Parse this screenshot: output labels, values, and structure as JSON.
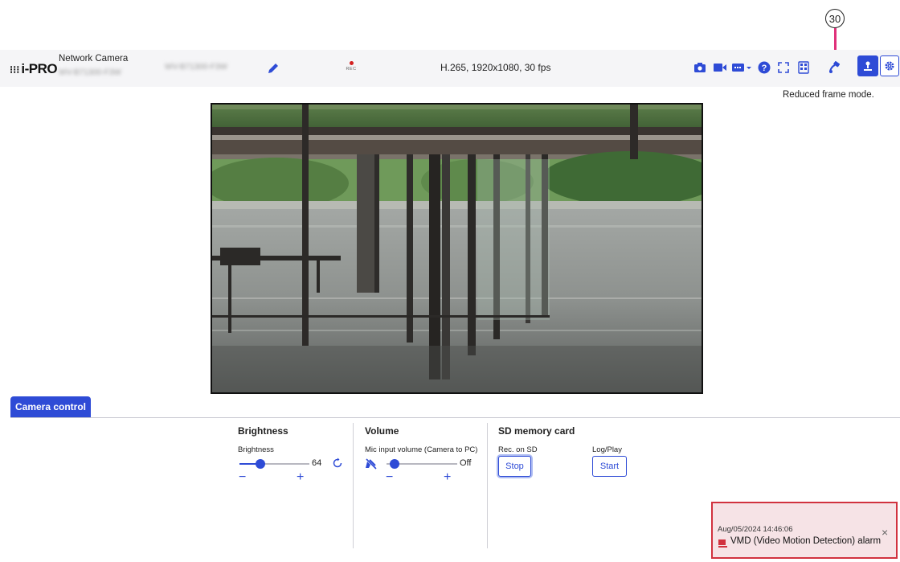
{
  "callout": {
    "number": "30"
  },
  "header": {
    "logo_dots": "⁝⁝⁝",
    "logo_text": "i-PRO",
    "brand_sub": "Network Camera",
    "model_blurred_1": "WV-B71300-F3W",
    "model_blurred_2": "WV-B71300-F3W",
    "rec_label": "REC",
    "stream_info": "H.265, 1920x1080, 30 fps",
    "reduced_frame_label": "Reduced frame mode.",
    "toolbar_icons": [
      "camera-snapshot-icon",
      "video-record-icon",
      "stream-select-icon",
      "help-icon",
      "fullscreen-icon",
      "grid-icon",
      "reduced-frame-icon",
      "live-icon",
      "settings-icon"
    ]
  },
  "camera_control": {
    "tab_label": "Camera control",
    "brightness": {
      "title": "Brightness",
      "label": "Brightness",
      "value": "64",
      "level_fraction": 0.3,
      "minus": "−",
      "plus": "+"
    },
    "volume": {
      "title": "Volume",
      "label": "Mic input volume (Camera to PC)",
      "value": "Off",
      "level_fraction": 0.0,
      "minus": "−",
      "plus": "+"
    },
    "sd_card": {
      "title": "SD memory card",
      "rec_label": "Rec. on SD",
      "rec_button": "Stop",
      "log_label": "Log/Play",
      "log_button": "Start"
    }
  },
  "alarm": {
    "timestamp": "Aug/05/2024 14:46:06",
    "message": "VMD (Video Motion Detection) alarm",
    "close": "×"
  },
  "colors": {
    "accent": "#2e4bd6",
    "alarm_border": "#d1323f",
    "alarm_bg": "#f6e3e6",
    "callout_line": "#e0317a"
  }
}
